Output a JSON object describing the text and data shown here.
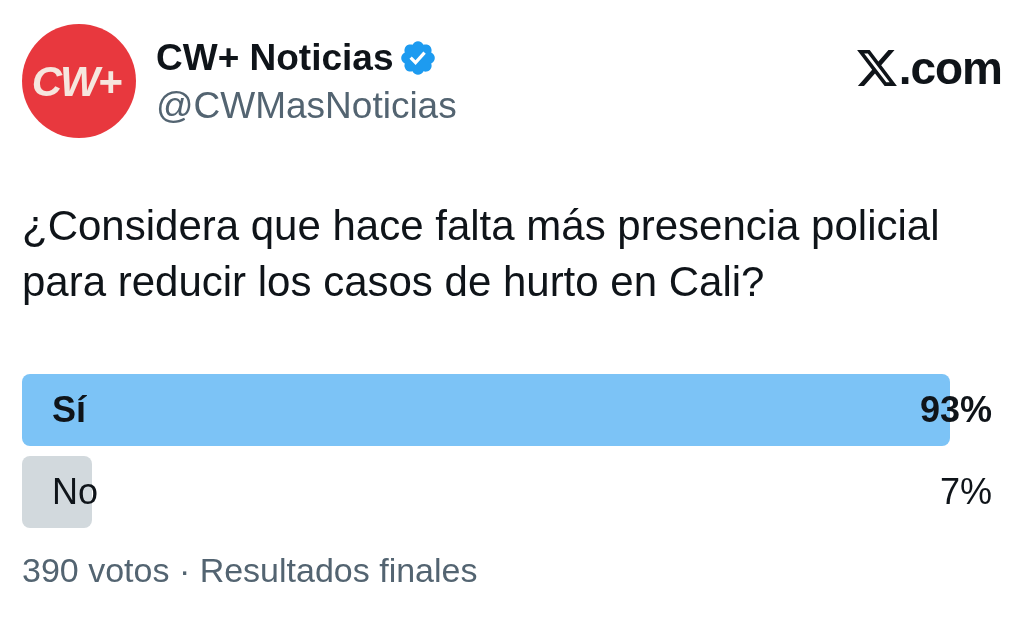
{
  "account": {
    "avatar_text": "CW+",
    "name": "CW+ Noticias",
    "verified": true,
    "handle": "@CWMasNoticias"
  },
  "site": {
    "label": ".com"
  },
  "question": "¿Considera que hace falta más presencia policial para reducir los casos de hurto en Cali?",
  "poll": {
    "options": [
      {
        "label": "Sí",
        "percent": "93%",
        "level": 0.93,
        "leading": true
      },
      {
        "label": "No",
        "percent": "7%",
        "level": 0.07,
        "leading": false
      }
    ],
    "footer": "390 votos · Resultados finales"
  }
}
